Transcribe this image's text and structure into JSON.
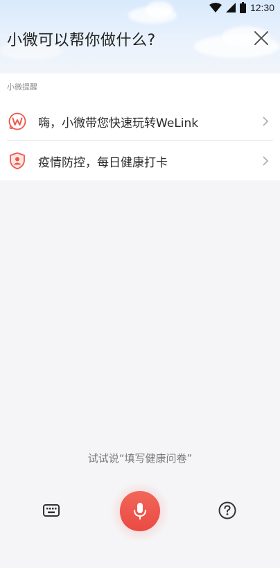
{
  "status_bar": {
    "time": "12:30",
    "icons": [
      "wifi-icon",
      "cellular-signal-icon",
      "battery-icon"
    ]
  },
  "header": {
    "title": "小微可以帮你做什么?",
    "close_icon": "close-icon"
  },
  "reminders": {
    "label": "小微提醒",
    "items": [
      {
        "label": "嗨，小微带您快速玩转WeLink",
        "icon": "welink-logo-icon"
      },
      {
        "label": "疫情防控，每日健康打卡",
        "icon": "health-shield-icon"
      }
    ]
  },
  "hint": {
    "text": "试试说“填写健康问卷”"
  },
  "bottom_bar": {
    "keyboard_icon": "keyboard-icon",
    "mic_icon": "microphone-icon",
    "help_icon": "help-icon"
  },
  "colors": {
    "accent": "#f0554a",
    "text_primary": "#222222",
    "text_secondary": "#8a8a8a"
  }
}
